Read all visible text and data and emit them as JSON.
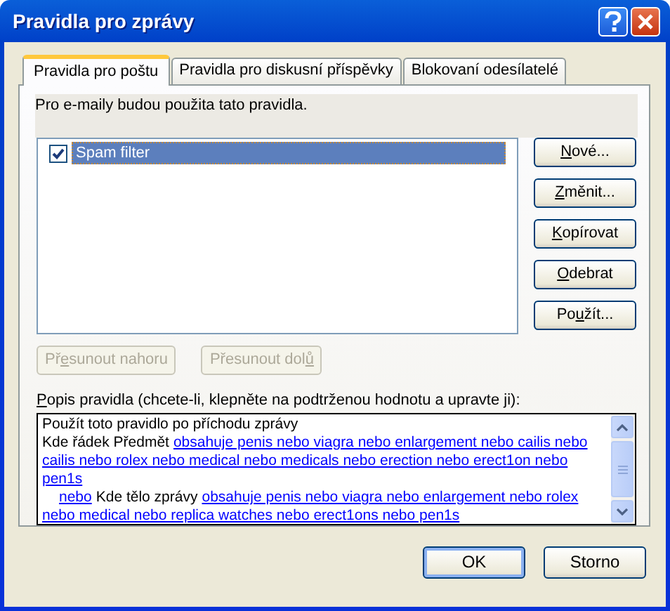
{
  "window": {
    "title": "Pravidla pro zprávy"
  },
  "tabs": [
    {
      "label": "Pravidla pro poštu",
      "selected": true
    },
    {
      "label": "Pravidla pro diskusní příspěvky",
      "selected": false
    },
    {
      "label": "Blokovaní odesílatelé",
      "selected": false
    }
  ],
  "intro": "Pro e-maily budou použita tato pravidla.",
  "rules": [
    {
      "name": "Spam filter",
      "checked": true,
      "selected": true
    }
  ],
  "side_buttons": [
    {
      "key": "N",
      "after": "ové..."
    },
    {
      "key": "Z",
      "after": "měnit..."
    },
    {
      "key": "K",
      "after": "opírovat"
    },
    {
      "key": "O",
      "after": "debrat"
    },
    {
      "before": "Po",
      "key": "u",
      "after": "žít..."
    }
  ],
  "move_buttons": [
    {
      "before": "Př",
      "key": "e",
      "after": "sunout nahoru",
      "disabled": true
    },
    {
      "before": "Přesunout dol",
      "key": "ů",
      "disabled": true
    }
  ],
  "description_label": {
    "key": "P",
    "after": "opis pravidla (chcete-li, klepněte na podtrženou hodnotu a upravte ji):"
  },
  "description": [
    {
      "kind": "plain",
      "parts": [
        {
          "kind": "text",
          "text": "Použít toto pravidlo po příchodu zprávy"
        }
      ]
    },
    {
      "kind": "plain",
      "parts": [
        {
          "kind": "text",
          "text": "Kde řádek Předmět"
        },
        {
          "kind": "link",
          "text": "obsahuje penis nebo viagra nebo enlargement nebo cailis nebo"
        }
      ]
    },
    {
      "kind": "plain",
      "parts": [
        {
          "kind": "link",
          "text": "cailis nebo rolex nebo medical nebo medicals nebo erection nebo erect1on nebo"
        }
      ]
    },
    {
      "kind": "plain",
      "parts": [
        {
          "kind": "link",
          "text": "pen1s"
        }
      ]
    },
    {
      "kind": "indented",
      "parts": [
        {
          "kind": "link",
          "text": "nebo"
        },
        {
          "kind": "text",
          "text": "Kde tělo zprávy"
        },
        {
          "kind": "link",
          "text": "obsahuje penis nebo viagra nebo enlargement nebo rolex"
        }
      ]
    },
    {
      "kind": "plain",
      "parts": [
        {
          "kind": "link",
          "text": "nebo medical nebo replica watches nebo erect1ons nebo pen1s"
        }
      ]
    }
  ],
  "footer_buttons": [
    {
      "label": "OK",
      "default": true
    },
    {
      "label": "Storno",
      "default": false
    }
  ]
}
